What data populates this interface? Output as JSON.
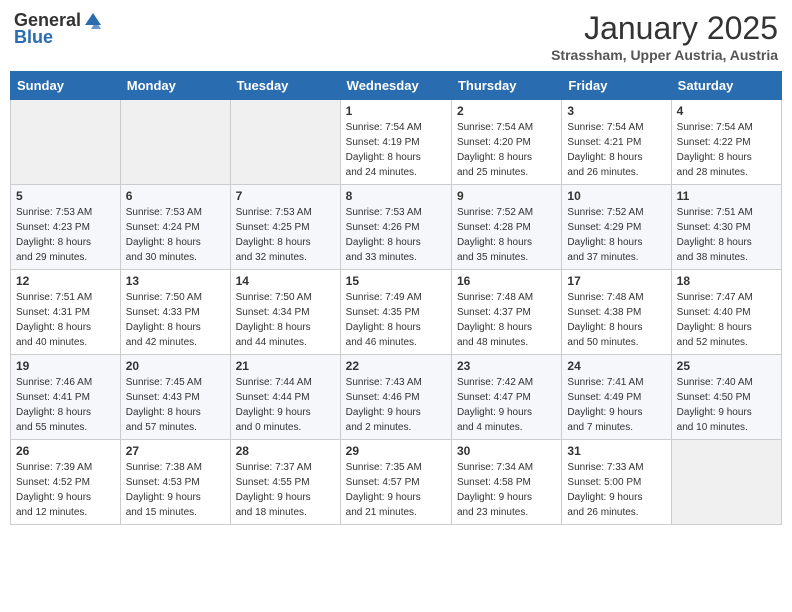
{
  "header": {
    "logo_general": "General",
    "logo_blue": "Blue",
    "month": "January 2025",
    "location": "Strassham, Upper Austria, Austria"
  },
  "weekdays": [
    "Sunday",
    "Monday",
    "Tuesday",
    "Wednesday",
    "Thursday",
    "Friday",
    "Saturday"
  ],
  "weeks": [
    [
      {
        "day": "",
        "info": ""
      },
      {
        "day": "",
        "info": ""
      },
      {
        "day": "",
        "info": ""
      },
      {
        "day": "1",
        "info": "Sunrise: 7:54 AM\nSunset: 4:19 PM\nDaylight: 8 hours\nand 24 minutes."
      },
      {
        "day": "2",
        "info": "Sunrise: 7:54 AM\nSunset: 4:20 PM\nDaylight: 8 hours\nand 25 minutes."
      },
      {
        "day": "3",
        "info": "Sunrise: 7:54 AM\nSunset: 4:21 PM\nDaylight: 8 hours\nand 26 minutes."
      },
      {
        "day": "4",
        "info": "Sunrise: 7:54 AM\nSunset: 4:22 PM\nDaylight: 8 hours\nand 28 minutes."
      }
    ],
    [
      {
        "day": "5",
        "info": "Sunrise: 7:53 AM\nSunset: 4:23 PM\nDaylight: 8 hours\nand 29 minutes."
      },
      {
        "day": "6",
        "info": "Sunrise: 7:53 AM\nSunset: 4:24 PM\nDaylight: 8 hours\nand 30 minutes."
      },
      {
        "day": "7",
        "info": "Sunrise: 7:53 AM\nSunset: 4:25 PM\nDaylight: 8 hours\nand 32 minutes."
      },
      {
        "day": "8",
        "info": "Sunrise: 7:53 AM\nSunset: 4:26 PM\nDaylight: 8 hours\nand 33 minutes."
      },
      {
        "day": "9",
        "info": "Sunrise: 7:52 AM\nSunset: 4:28 PM\nDaylight: 8 hours\nand 35 minutes."
      },
      {
        "day": "10",
        "info": "Sunrise: 7:52 AM\nSunset: 4:29 PM\nDaylight: 8 hours\nand 37 minutes."
      },
      {
        "day": "11",
        "info": "Sunrise: 7:51 AM\nSunset: 4:30 PM\nDaylight: 8 hours\nand 38 minutes."
      }
    ],
    [
      {
        "day": "12",
        "info": "Sunrise: 7:51 AM\nSunset: 4:31 PM\nDaylight: 8 hours\nand 40 minutes."
      },
      {
        "day": "13",
        "info": "Sunrise: 7:50 AM\nSunset: 4:33 PM\nDaylight: 8 hours\nand 42 minutes."
      },
      {
        "day": "14",
        "info": "Sunrise: 7:50 AM\nSunset: 4:34 PM\nDaylight: 8 hours\nand 44 minutes."
      },
      {
        "day": "15",
        "info": "Sunrise: 7:49 AM\nSunset: 4:35 PM\nDaylight: 8 hours\nand 46 minutes."
      },
      {
        "day": "16",
        "info": "Sunrise: 7:48 AM\nSunset: 4:37 PM\nDaylight: 8 hours\nand 48 minutes."
      },
      {
        "day": "17",
        "info": "Sunrise: 7:48 AM\nSunset: 4:38 PM\nDaylight: 8 hours\nand 50 minutes."
      },
      {
        "day": "18",
        "info": "Sunrise: 7:47 AM\nSunset: 4:40 PM\nDaylight: 8 hours\nand 52 minutes."
      }
    ],
    [
      {
        "day": "19",
        "info": "Sunrise: 7:46 AM\nSunset: 4:41 PM\nDaylight: 8 hours\nand 55 minutes."
      },
      {
        "day": "20",
        "info": "Sunrise: 7:45 AM\nSunset: 4:43 PM\nDaylight: 8 hours\nand 57 minutes."
      },
      {
        "day": "21",
        "info": "Sunrise: 7:44 AM\nSunset: 4:44 PM\nDaylight: 9 hours\nand 0 minutes."
      },
      {
        "day": "22",
        "info": "Sunrise: 7:43 AM\nSunset: 4:46 PM\nDaylight: 9 hours\nand 2 minutes."
      },
      {
        "day": "23",
        "info": "Sunrise: 7:42 AM\nSunset: 4:47 PM\nDaylight: 9 hours\nand 4 minutes."
      },
      {
        "day": "24",
        "info": "Sunrise: 7:41 AM\nSunset: 4:49 PM\nDaylight: 9 hours\nand 7 minutes."
      },
      {
        "day": "25",
        "info": "Sunrise: 7:40 AM\nSunset: 4:50 PM\nDaylight: 9 hours\nand 10 minutes."
      }
    ],
    [
      {
        "day": "26",
        "info": "Sunrise: 7:39 AM\nSunset: 4:52 PM\nDaylight: 9 hours\nand 12 minutes."
      },
      {
        "day": "27",
        "info": "Sunrise: 7:38 AM\nSunset: 4:53 PM\nDaylight: 9 hours\nand 15 minutes."
      },
      {
        "day": "28",
        "info": "Sunrise: 7:37 AM\nSunset: 4:55 PM\nDaylight: 9 hours\nand 18 minutes."
      },
      {
        "day": "29",
        "info": "Sunrise: 7:35 AM\nSunset: 4:57 PM\nDaylight: 9 hours\nand 21 minutes."
      },
      {
        "day": "30",
        "info": "Sunrise: 7:34 AM\nSunset: 4:58 PM\nDaylight: 9 hours\nand 23 minutes."
      },
      {
        "day": "31",
        "info": "Sunrise: 7:33 AM\nSunset: 5:00 PM\nDaylight: 9 hours\nand 26 minutes."
      },
      {
        "day": "",
        "info": ""
      }
    ]
  ]
}
